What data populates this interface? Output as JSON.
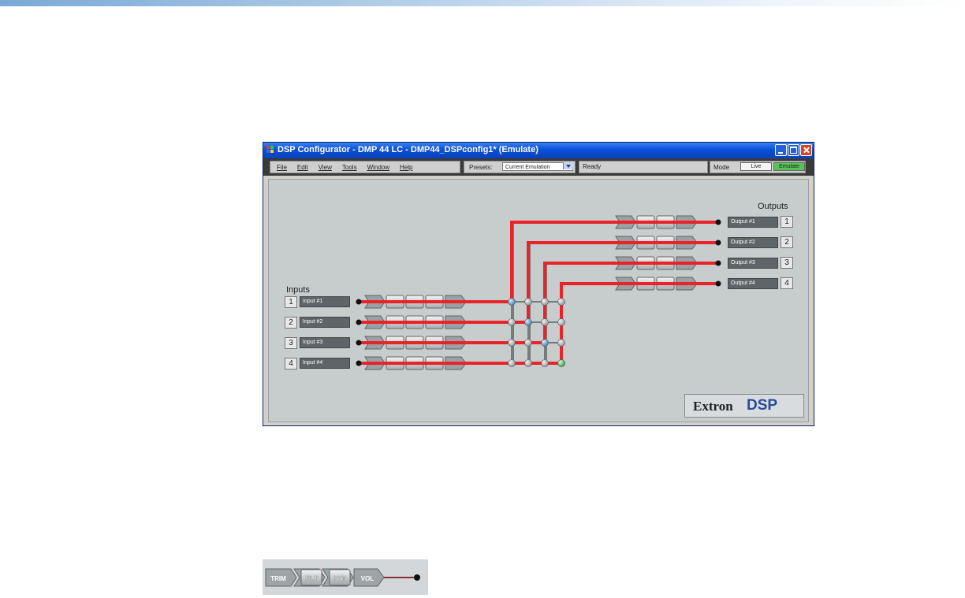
{
  "window": {
    "title": "DSP Configurator - DMP 44 LC - DMP44_DSPconfig1* (Emulate)"
  },
  "menu": [
    "File",
    "Edit",
    "View",
    "Tools",
    "Window",
    "Help"
  ],
  "presets": {
    "label": "Presets:",
    "value": "Current Emulation"
  },
  "status": "Ready",
  "mode": {
    "label": "Mode",
    "live": "Live",
    "emulate": "Emulate",
    "active": "Emulate"
  },
  "inputs": {
    "heading": "Inputs",
    "items": [
      {
        "num": "1",
        "name": "Input #1"
      },
      {
        "num": "2",
        "name": "Input #2"
      },
      {
        "num": "3",
        "name": "Input #3"
      },
      {
        "num": "4",
        "name": "Input #4"
      }
    ]
  },
  "outputs": {
    "heading": "Outputs",
    "items": [
      {
        "num": "1",
        "name": "Output #1"
      },
      {
        "num": "2",
        "name": "Output #2"
      },
      {
        "num": "3",
        "name": "Output #3"
      },
      {
        "num": "4",
        "name": "Output #4"
      }
    ]
  },
  "logo": {
    "brand": "Extron",
    "product": "DSP"
  },
  "strip": {
    "blocks": [
      "TRIM",
      "FILT",
      "DYN",
      "VOL"
    ]
  },
  "colors": {
    "signal": "#e8232a",
    "canvas": "#c7cccd",
    "emulate": "#55c455",
    "titlebar": "#0b50d8"
  }
}
